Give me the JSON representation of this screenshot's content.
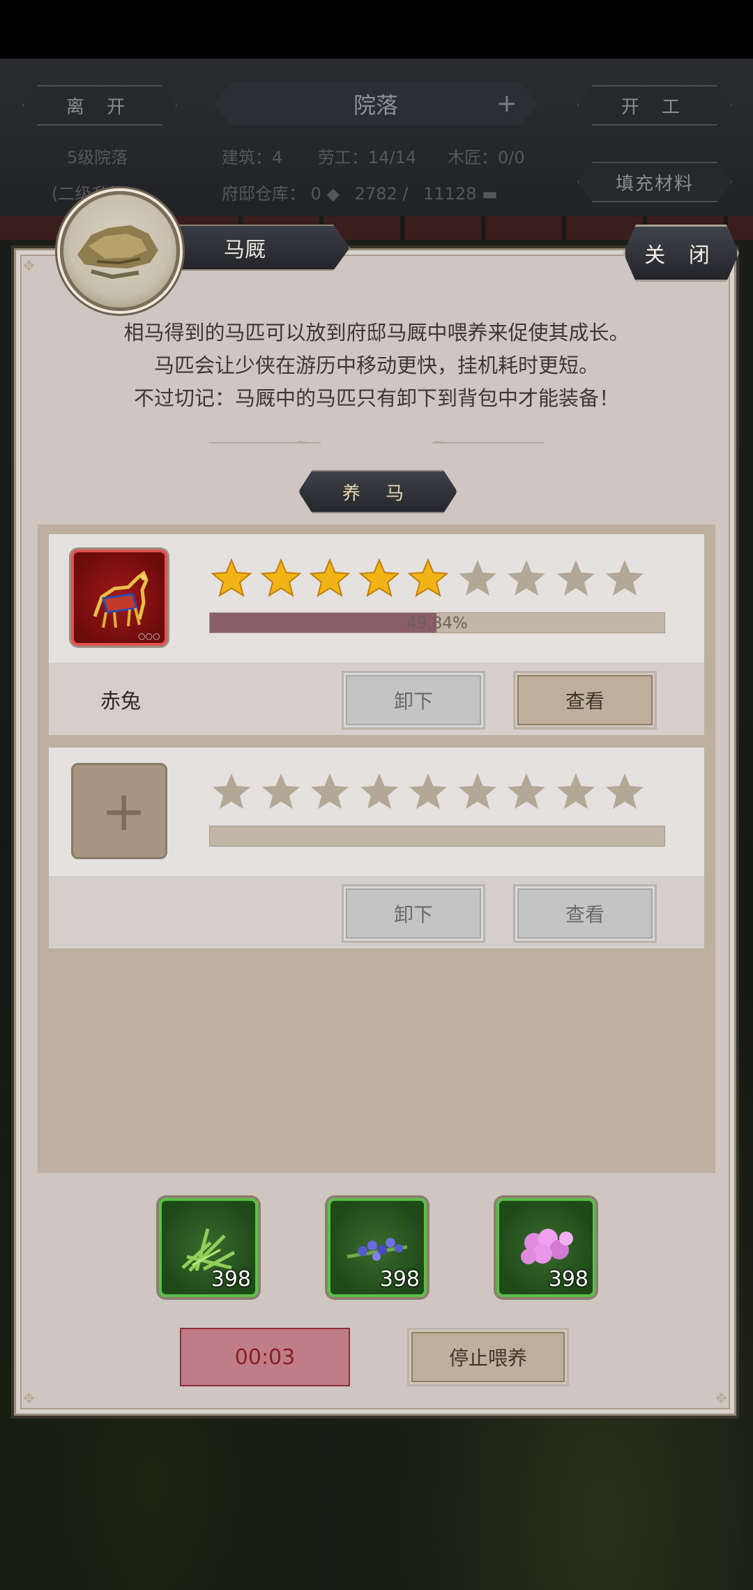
{
  "header": {
    "leave_label": "离 开",
    "title": "院落",
    "start_work_label": "开 工",
    "fill_material_label": "填充材料",
    "level_text": "5级院落",
    "sub_level_text": "(二级升级)",
    "building_text": "建筑：4",
    "labor_text": "劳工：14/14",
    "carpenter_text": "木匠：0/0",
    "warehouse_label": "府邸仓库：",
    "warehouse_values": [
      "0",
      "2782",
      "11128"
    ]
  },
  "dialog": {
    "title": "马厩",
    "close_label": "关 闭",
    "intro_lines": [
      "相马得到的马匹可以放到府邸马厩中喂养来促使其成长。",
      "马匹会让少侠在游历中移动更快，挂机耗时更短。",
      "不过切记：马厩中的马匹只有卸下到背包中才能装备！"
    ],
    "section_label": "养 马"
  },
  "slots": [
    {
      "name": "赤兔",
      "stars_filled": 5,
      "stars_total": 9,
      "progress_percent": 49.84,
      "progress_text": "49.84%",
      "unload_label": "卸下",
      "view_label": "查看",
      "icon": "red-horse-icon"
    },
    {
      "name": "",
      "stars_filled": 0,
      "stars_total": 9,
      "progress_percent": 0,
      "progress_text": "",
      "unload_label": "卸下",
      "view_label": "查看",
      "icon": "add-horse-icon"
    }
  ],
  "feeds": [
    {
      "count": "398",
      "icon": "green-grass-icon"
    },
    {
      "count": "398",
      "icon": "blue-flower-icon"
    },
    {
      "count": "398",
      "icon": "pink-flower-icon"
    }
  ],
  "timer_text": "00:03",
  "stop_feeding_label": "停止喂养",
  "colors": {
    "panel": "#cfc6c2",
    "star_gold": "#f0b417",
    "star_empty": "#b3a896",
    "progress_fill": "#8a5d6a",
    "timer_bg": "#bf7d87"
  }
}
